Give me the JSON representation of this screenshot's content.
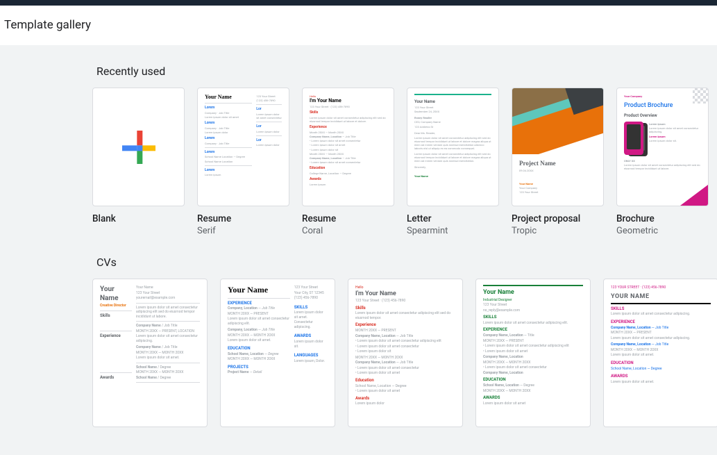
{
  "header": {
    "title": "Template gallery"
  },
  "sections": {
    "recent": {
      "title": "Recently used",
      "cards": [
        {
          "title": "Blank",
          "subtitle": ""
        },
        {
          "title": "Resume",
          "subtitle": "Serif"
        },
        {
          "title": "Resume",
          "subtitle": "Coral"
        },
        {
          "title": "Letter",
          "subtitle": "Spearmint"
        },
        {
          "title": "Project proposal",
          "subtitle": "Tropic"
        },
        {
          "title": "Brochure",
          "subtitle": "Geometric"
        }
      ]
    },
    "cvs": {
      "title": "CVs"
    }
  },
  "thumbs": {
    "your_name": "Your Name",
    "i_m_your_name": "I'm Your Name",
    "your_company": "Your Company",
    "product_brochure": "Product Brochure",
    "product_overview": "Product Overview",
    "project_name": "Project Name",
    "skills": "SKILLS",
    "experience": "EXPERIENCE",
    "education": "EDUCATION",
    "awards": "AWARDS",
    "creative_director": "Creative Director",
    "industrial_designer": "Industrial Designer",
    "name_caps": "YOUR NAME"
  }
}
